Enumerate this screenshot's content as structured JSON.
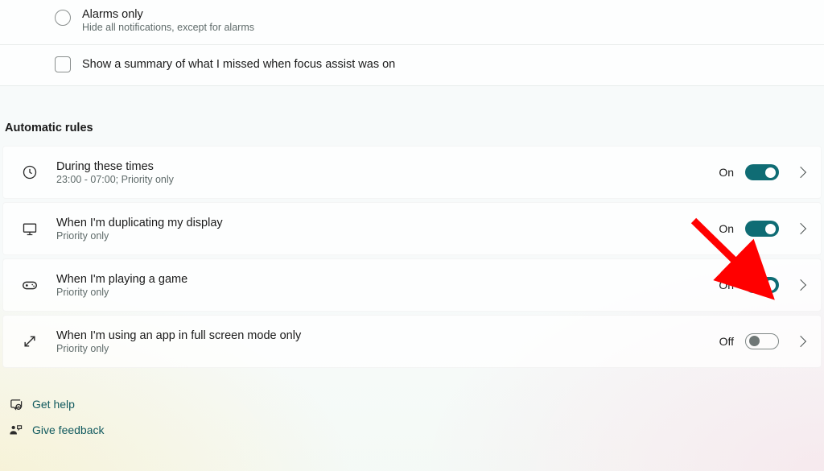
{
  "top": {
    "radio_alarms": {
      "title": "Alarms only",
      "sub": "Hide all notifications, except for alarms"
    },
    "summary_label": "Show a summary of what I missed when focus assist was on"
  },
  "section_heading": "Automatic rules",
  "rules": {
    "times": {
      "title": "During these times",
      "sub": "23:00 - 07:00; Priority only",
      "state": "On"
    },
    "display": {
      "title": "When I'm duplicating my display",
      "sub": "Priority only",
      "state": "On"
    },
    "game": {
      "title": "When I'm playing a game",
      "sub": "Priority only",
      "state": "On"
    },
    "fullscreen": {
      "title": "When I'm using an app in full screen mode only",
      "sub": "Priority only",
      "state": "Off"
    }
  },
  "links": {
    "help": "Get help",
    "feedback": "Give feedback"
  },
  "colors": {
    "accent": "#0f6c74",
    "link": "#10595e"
  }
}
